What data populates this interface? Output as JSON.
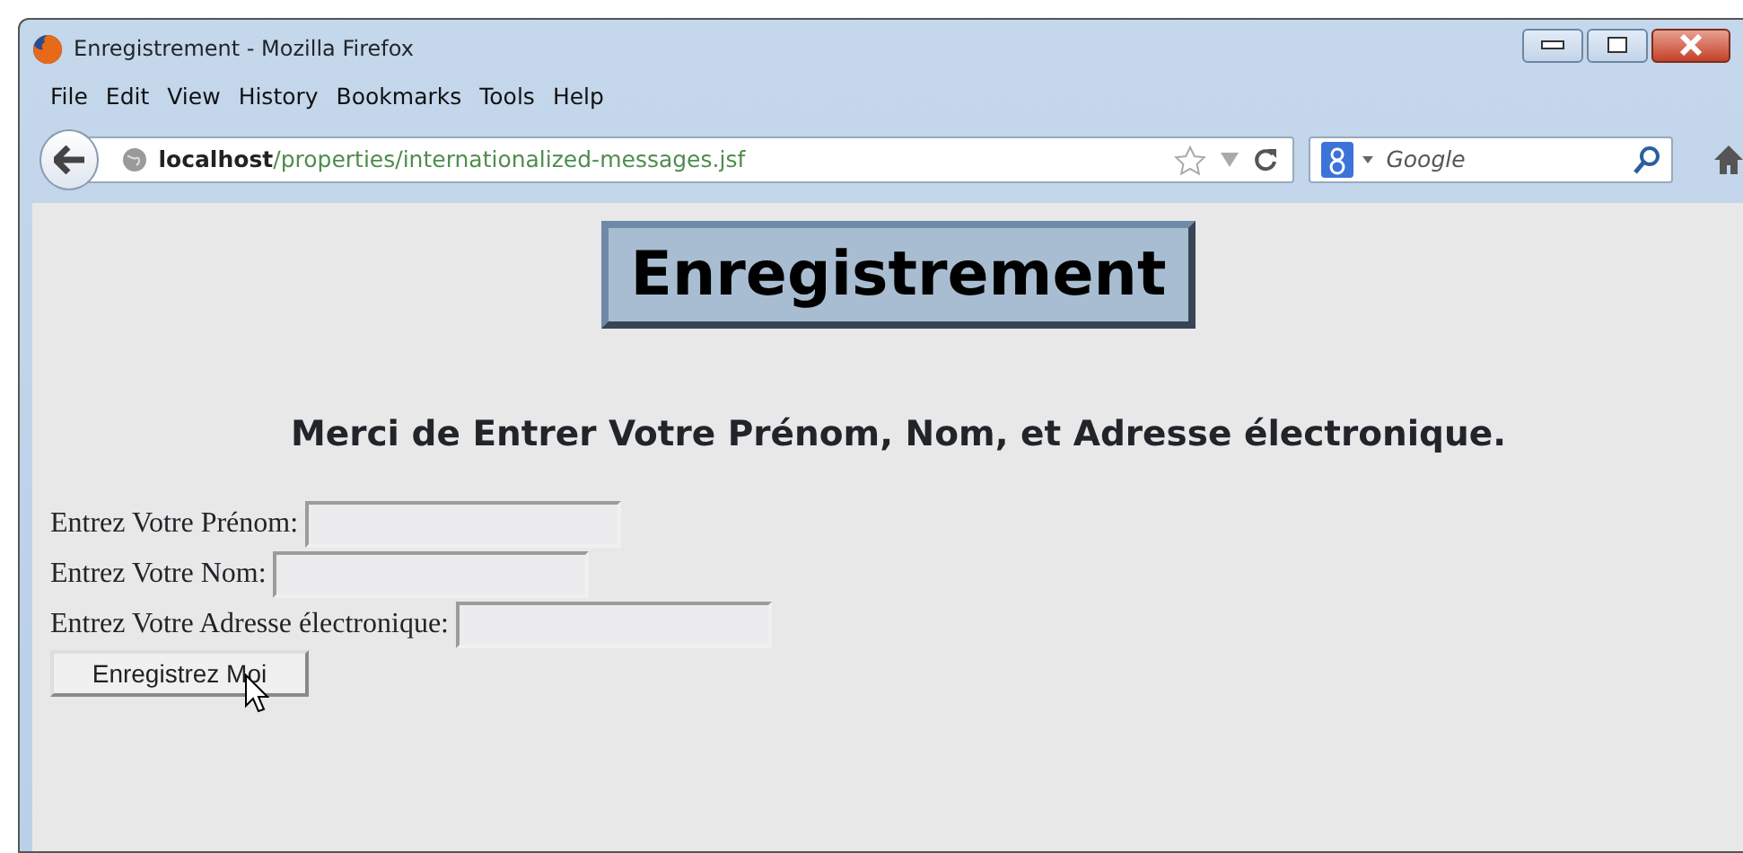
{
  "window": {
    "title": "Enregistrement - Mozilla Firefox"
  },
  "menu": [
    "File",
    "Edit",
    "View",
    "History",
    "Bookmarks",
    "Tools",
    "Help"
  ],
  "address_bar": {
    "host": "localhost",
    "path": "/properties/internationalized-messages.jsf"
  },
  "search": {
    "placeholder": "Google"
  },
  "page": {
    "heading": "Enregistrement",
    "subheading": "Merci de Entrer Votre Prénom, Nom, et Adresse électronique.",
    "fields": [
      {
        "label": "Entrez Votre Prénom:"
      },
      {
        "label": "Entrez Votre Nom:"
      },
      {
        "label": "Entrez Votre Adresse électronique:"
      }
    ],
    "submit": "Enregistrez Moi"
  }
}
